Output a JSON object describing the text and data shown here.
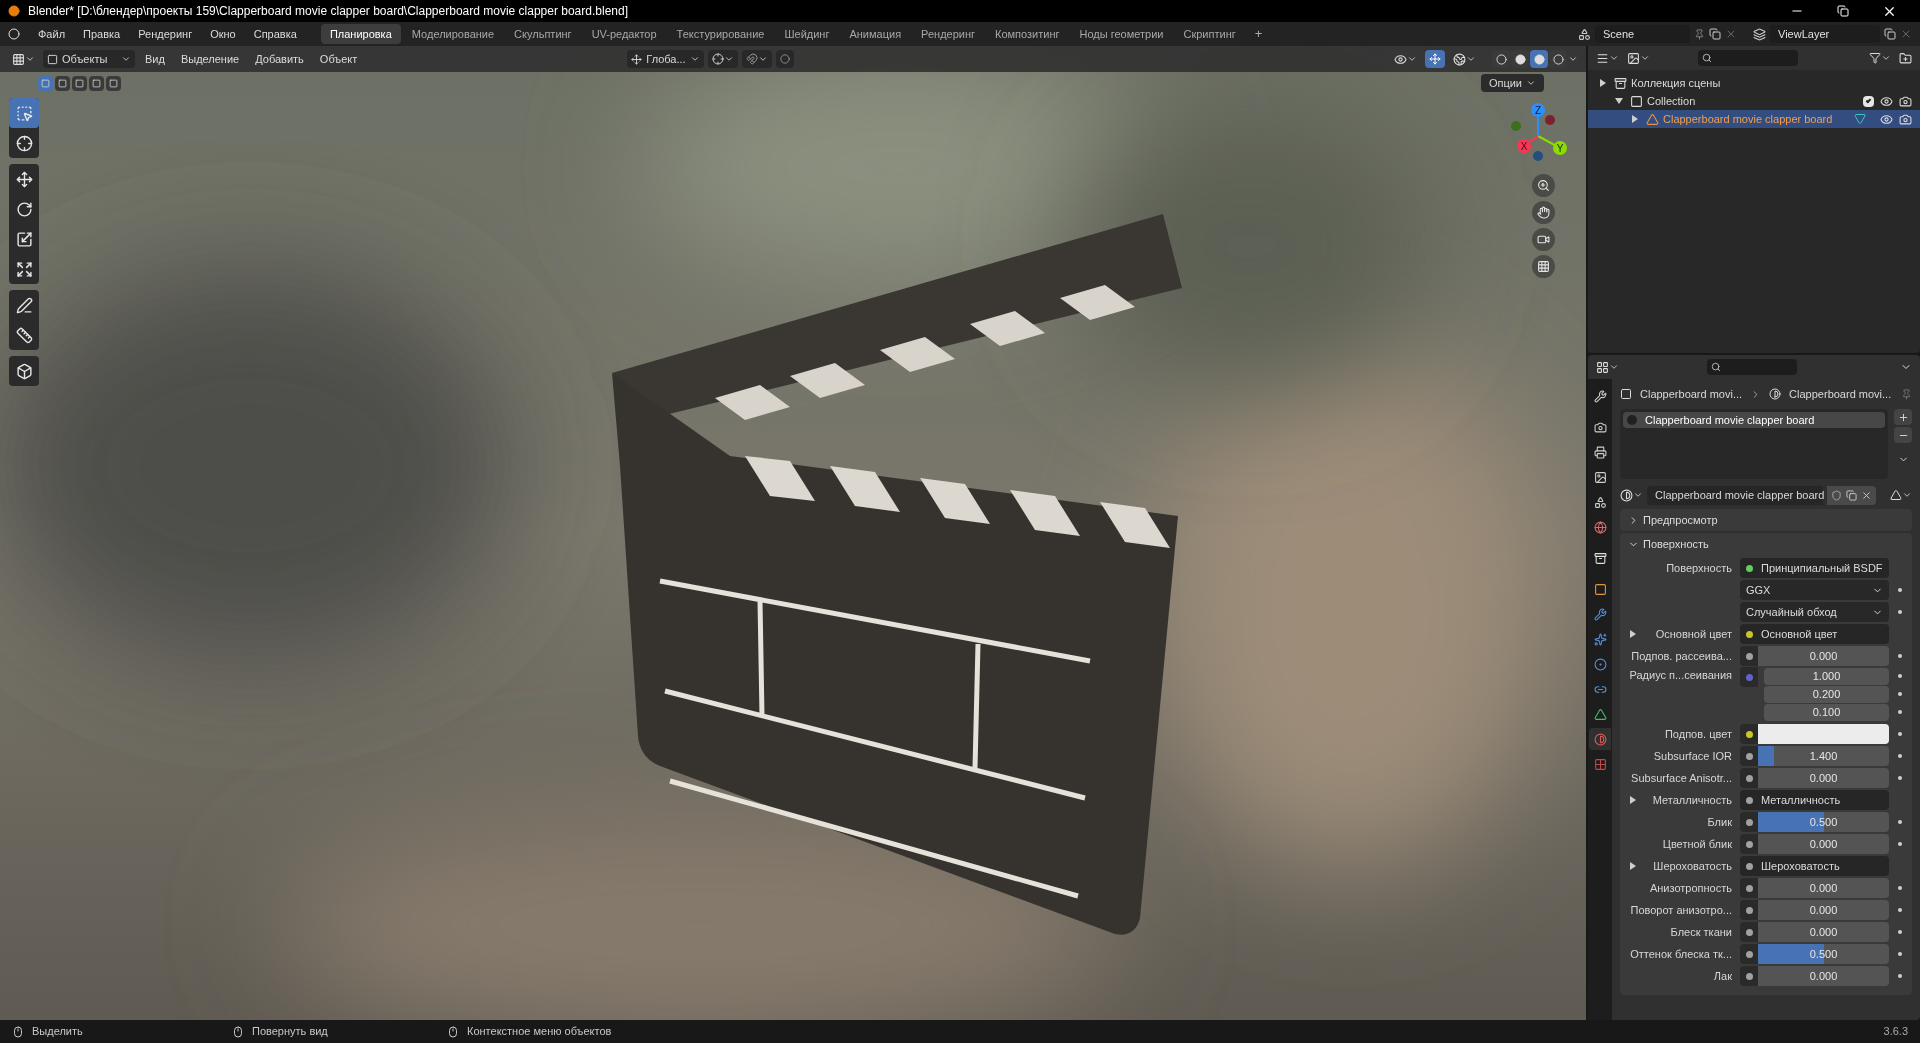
{
  "title_bar": {
    "title": "Blender* [D:\\блендер\\проекты 159\\Clapperboard movie clapper board\\Clapperboard movie clapper board.blend]"
  },
  "menu": [
    "Файл",
    "Правка",
    "Рендеринг",
    "Окно",
    "Справка"
  ],
  "workspaces": [
    {
      "label": "Планировка",
      "selected": true
    },
    {
      "label": "Моделирование",
      "selected": false
    },
    {
      "label": "Скульптинг",
      "selected": false
    },
    {
      "label": "UV-редактор",
      "selected": false
    },
    {
      "label": "Текстурирование",
      "selected": false
    },
    {
      "label": "Шейдинг",
      "selected": false
    },
    {
      "label": "Анимация",
      "selected": false
    },
    {
      "label": "Рендеринг",
      "selected": false
    },
    {
      "label": "Композитинг",
      "selected": false
    },
    {
      "label": "Ноды геометрии",
      "selected": false
    },
    {
      "label": "Скриптинг",
      "selected": false
    }
  ],
  "add_workspace": "+",
  "scene": "Scene",
  "view_layer": "ViewLayer",
  "viewport": {
    "mode": "Объекты",
    "menus": [
      "Вид",
      "Выделение",
      "Добавить",
      "Объект"
    ],
    "orientation": "Глоба...",
    "options": "Опции",
    "select_modes": [
      {
        "selected": true
      },
      {
        "selected": false
      },
      {
        "selected": false
      },
      {
        "selected": false
      },
      {
        "selected": false
      }
    ],
    "shading": [
      {
        "selected": false
      },
      {
        "selected": false
      },
      {
        "selected": true
      },
      {
        "selected": false
      }
    ],
    "tools": [
      {
        "kind": "select",
        "selected": true
      },
      {
        "kind": "cursor",
        "selected": false
      },
      {
        "kind": "move",
        "selected": false
      },
      {
        "kind": "rotate",
        "selected": false
      },
      {
        "kind": "scale",
        "selected": false
      },
      {
        "kind": "transform",
        "selected": false
      },
      {
        "kind": "annotate",
        "selected": false
      },
      {
        "kind": "measure",
        "selected": false
      },
      {
        "kind": "add_cube",
        "selected": false
      }
    ],
    "gizmo": {
      "x": "X",
      "y": "Y",
      "z": "Z"
    }
  },
  "outliner": {
    "items": [
      {
        "kind": "scene_collection",
        "label": "Коллекция сцены",
        "selected": false,
        "children": [
          {
            "kind": "collection",
            "label": "Collection",
            "selected": false,
            "expanded": true,
            "checked": true,
            "children": [
              {
                "kind": "object",
                "label": "Clapperboard movie clapper board",
                "selected": true
              }
            ]
          }
        ]
      }
    ]
  },
  "properties": {
    "tabs": [
      {
        "kind": "tool",
        "selected": false
      },
      {
        "kind": "render",
        "selected": false
      },
      {
        "kind": "output",
        "selected": false
      },
      {
        "kind": "view_layer",
        "selected": false
      },
      {
        "kind": "scene",
        "selected": false
      },
      {
        "kind": "world",
        "selected": false
      },
      {
        "kind": "collection",
        "selected": false
      },
      {
        "kind": "object",
        "selected": false
      },
      {
        "kind": "modifier",
        "selected": false
      },
      {
        "kind": "particles",
        "selected": false
      },
      {
        "kind": "physics",
        "selected": false
      },
      {
        "kind": "constraints",
        "selected": false
      },
      {
        "kind": "data",
        "selected": false
      },
      {
        "kind": "material",
        "selected": true
      },
      {
        "kind": "texture",
        "selected": false
      }
    ],
    "breadcrumb": [
      "Clapperboard movi...",
      "Clapperboard movi..."
    ],
    "slots": [
      {
        "label": "Clapperboard movie clapper board",
        "selected": true
      }
    ],
    "material": "Clapperboard movie clapper board",
    "panels": [
      {
        "title": "Предпросмотр",
        "expanded": false
      },
      {
        "title": "Поверхность",
        "expanded": true
      }
    ],
    "rows": [
      {
        "kind": "link",
        "label": "Поверхность",
        "color": "#5fcf5f",
        "value": "Принципиальный BSDF"
      },
      {
        "kind": "dropdown",
        "value": "GGX"
      },
      {
        "kind": "dropdown",
        "value": "Случайный обход"
      },
      {
        "kind": "link",
        "label": "Основной цвет",
        "color": "#c7c729",
        "value": "Основной цвет",
        "expandable": true
      },
      {
        "kind": "number",
        "label": "Подпов. рассеива...",
        "color": "#a1a1a1",
        "value": "0.000",
        "level": 0
      },
      {
        "kind": "vector",
        "label": "Радиус п...сеивания",
        "color": "#6363c7",
        "values": [
          "1.000",
          "0.200",
          "0.100"
        ]
      },
      {
        "kind": "color",
        "label": "Подпов. цвет",
        "color": "#c7c729"
      },
      {
        "kind": "number",
        "label": "Subsurface IOR",
        "color": "#a1a1a1",
        "value": "1.400",
        "level": 0.12
      },
      {
        "kind": "number",
        "label": "Subsurface Anisotr...",
        "color": "#a1a1a1",
        "value": "0.000",
        "level": 0
      },
      {
        "kind": "link",
        "label": "Металличность",
        "color": "#a1a1a1",
        "value": "Металличность",
        "expandable": true
      },
      {
        "kind": "number",
        "label": "Блик",
        "color": "#a1a1a1",
        "value": "0.500",
        "level": 0.5
      },
      {
        "kind": "number",
        "label": "Цветной блик",
        "color": "#a1a1a1",
        "value": "0.000",
        "level": 0
      },
      {
        "kind": "link",
        "label": "Шероховатость",
        "color": "#a1a1a1",
        "value": "Шероховатость",
        "expandable": true
      },
      {
        "kind": "number",
        "label": "Анизотропность",
        "color": "#a1a1a1",
        "value": "0.000",
        "level": 0
      },
      {
        "kind": "number",
        "label": "Поворот анизотро...",
        "color": "#a1a1a1",
        "value": "0.000",
        "level": 0
      },
      {
        "kind": "number",
        "label": "Блеск ткани",
        "color": "#a1a1a1",
        "value": "0.000",
        "level": 0
      },
      {
        "kind": "number",
        "label": "Оттенок блеска тк...",
        "color": "#a1a1a1",
        "value": "0.500",
        "level": 0.5
      },
      {
        "kind": "number",
        "label": "Лак",
        "color": "#a1a1a1",
        "value": "0.000",
        "level": 0
      }
    ]
  },
  "status_bar": {
    "hints": [
      "Выделить",
      "Повернуть вид",
      "Контекстное меню объектов"
    ],
    "version": "3.6.3"
  }
}
